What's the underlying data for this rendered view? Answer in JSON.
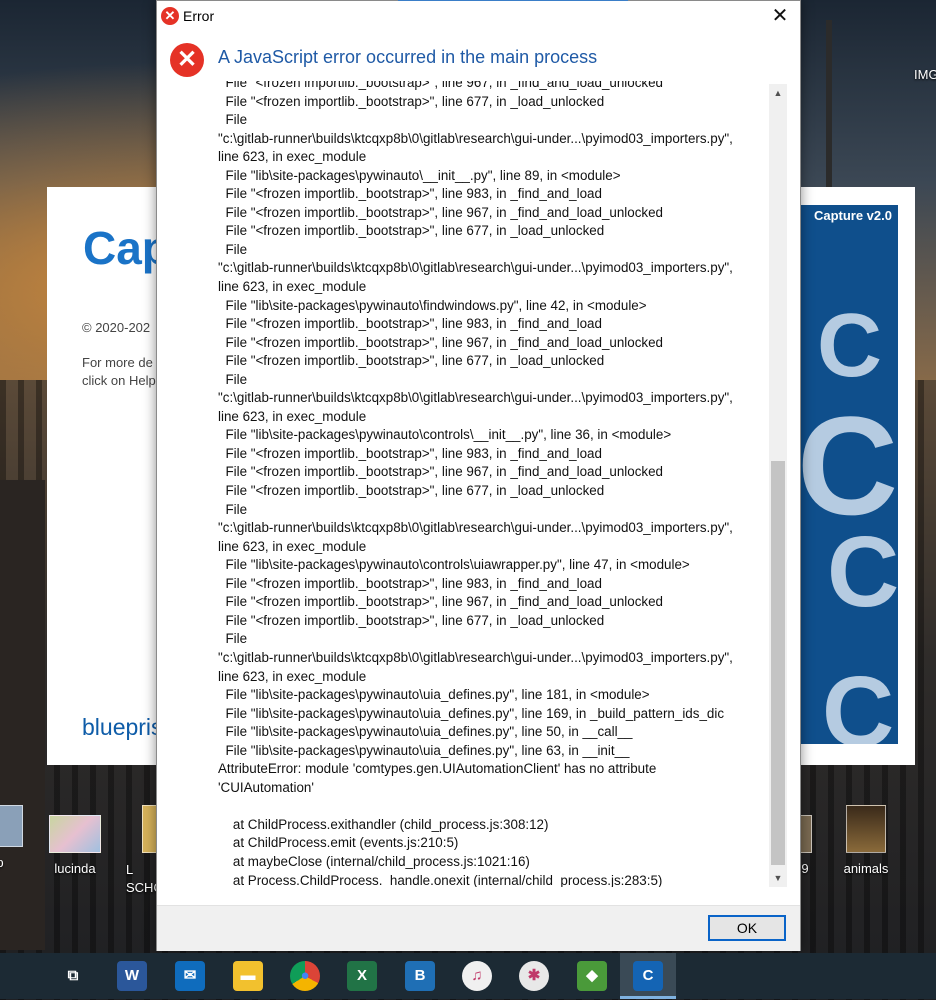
{
  "desktop": {
    "icons": [
      {
        "label": "p"
      },
      {
        "label": "lucinda"
      },
      {
        "label": "L SCHO"
      },
      {
        "label": "9"
      },
      {
        "label": "animals"
      }
    ],
    "top_right_label": "IMG"
  },
  "background_app": {
    "title": "Cap",
    "copyright": "© 2020-202",
    "more_info": "For more de click on Help",
    "brand": "bluepris",
    "banner_label": "Capture v2.0"
  },
  "dialog": {
    "window_title": "Error",
    "close_symbol": "✕",
    "heading": "A JavaScript error occurred in the main process",
    "message": "  File \"<frozen importlib._bootstrap>\", line 967, in _find_and_load_unlocked\n  File \"<frozen importlib._bootstrap>\", line 677, in _load_unlocked\n  File\n\"c:\\gitlab-runner\\builds\\ktcqxp8b\\0\\gitlab\\research\\gui-under...\\pyimod03_importers.py\",\nline 623, in exec_module\n  File \"lib\\site-packages\\pywinauto\\__init__.py\", line 89, in <module>\n  File \"<frozen importlib._bootstrap>\", line 983, in _find_and_load\n  File \"<frozen importlib._bootstrap>\", line 967, in _find_and_load_unlocked\n  File \"<frozen importlib._bootstrap>\", line 677, in _load_unlocked\n  File\n\"c:\\gitlab-runner\\builds\\ktcqxp8b\\0\\gitlab\\research\\gui-under...\\pyimod03_importers.py\",\nline 623, in exec_module\n  File \"lib\\site-packages\\pywinauto\\findwindows.py\", line 42, in <module>\n  File \"<frozen importlib._bootstrap>\", line 983, in _find_and_load\n  File \"<frozen importlib._bootstrap>\", line 967, in _find_and_load_unlocked\n  File \"<frozen importlib._bootstrap>\", line 677, in _load_unlocked\n  File\n\"c:\\gitlab-runner\\builds\\ktcqxp8b\\0\\gitlab\\research\\gui-under...\\pyimod03_importers.py\",\nline 623, in exec_module\n  File \"lib\\site-packages\\pywinauto\\controls\\__init__.py\", line 36, in <module>\n  File \"<frozen importlib._bootstrap>\", line 983, in _find_and_load\n  File \"<frozen importlib._bootstrap>\", line 967, in _find_and_load_unlocked\n  File \"<frozen importlib._bootstrap>\", line 677, in _load_unlocked\n  File\n\"c:\\gitlab-runner\\builds\\ktcqxp8b\\0\\gitlab\\research\\gui-under...\\pyimod03_importers.py\",\nline 623, in exec_module\n  File \"lib\\site-packages\\pywinauto\\controls\\uiawrapper.py\", line 47, in <module>\n  File \"<frozen importlib._bootstrap>\", line 983, in _find_and_load\n  File \"<frozen importlib._bootstrap>\", line 967, in _find_and_load_unlocked\n  File \"<frozen importlib._bootstrap>\", line 677, in _load_unlocked\n  File\n\"c:\\gitlab-runner\\builds\\ktcqxp8b\\0\\gitlab\\research\\gui-under...\\pyimod03_importers.py\",\nline 623, in exec_module\n  File \"lib\\site-packages\\pywinauto\\uia_defines.py\", line 181, in <module>\n  File \"lib\\site-packages\\pywinauto\\uia_defines.py\", line 169, in _build_pattern_ids_dic\n  File \"lib\\site-packages\\pywinauto\\uia_defines.py\", line 50, in __call__\n  File \"lib\\site-packages\\pywinauto\\uia_defines.py\", line 63, in __init__\nAttributeError: module 'comtypes.gen.UIAutomationClient' has no attribute\n'CUIAutomation'\n\n    at ChildProcess.exithandler (child_process.js:308:12)\n    at ChildProcess.emit (events.js:210:5)\n    at maybeClose (internal/child_process.js:1021:16)\n    at Process.ChildProcess._handle.onexit (internal/child_process.js:283:5)",
    "ok_label": "OK",
    "scroll_up_symbol": "▲",
    "scroll_down_symbol": "▼"
  },
  "taskbar": {
    "items": [
      {
        "name": "task-view",
        "glyph": "⧉"
      },
      {
        "name": "word",
        "glyph": "W",
        "color": "#2b579a"
      },
      {
        "name": "mail",
        "glyph": "✉",
        "color": "#0f6cbd"
      },
      {
        "name": "file-explorer",
        "glyph": "▬",
        "color": "#f2c12e"
      },
      {
        "name": "chrome",
        "glyph": "●",
        "color": "#e0493a"
      },
      {
        "name": "excel",
        "glyph": "X",
        "color": "#217346"
      },
      {
        "name": "blueprism",
        "glyph": "B",
        "color": "#1f6fb5"
      },
      {
        "name": "itunes",
        "glyph": "♫",
        "color": "#f0f0f0"
      },
      {
        "name": "slack",
        "glyph": "✱",
        "color": "#e8e8e8"
      },
      {
        "name": "shield-app",
        "glyph": "◆",
        "color": "#4a9a3a"
      },
      {
        "name": "capture",
        "glyph": "C",
        "color": "#1464b4"
      }
    ]
  }
}
